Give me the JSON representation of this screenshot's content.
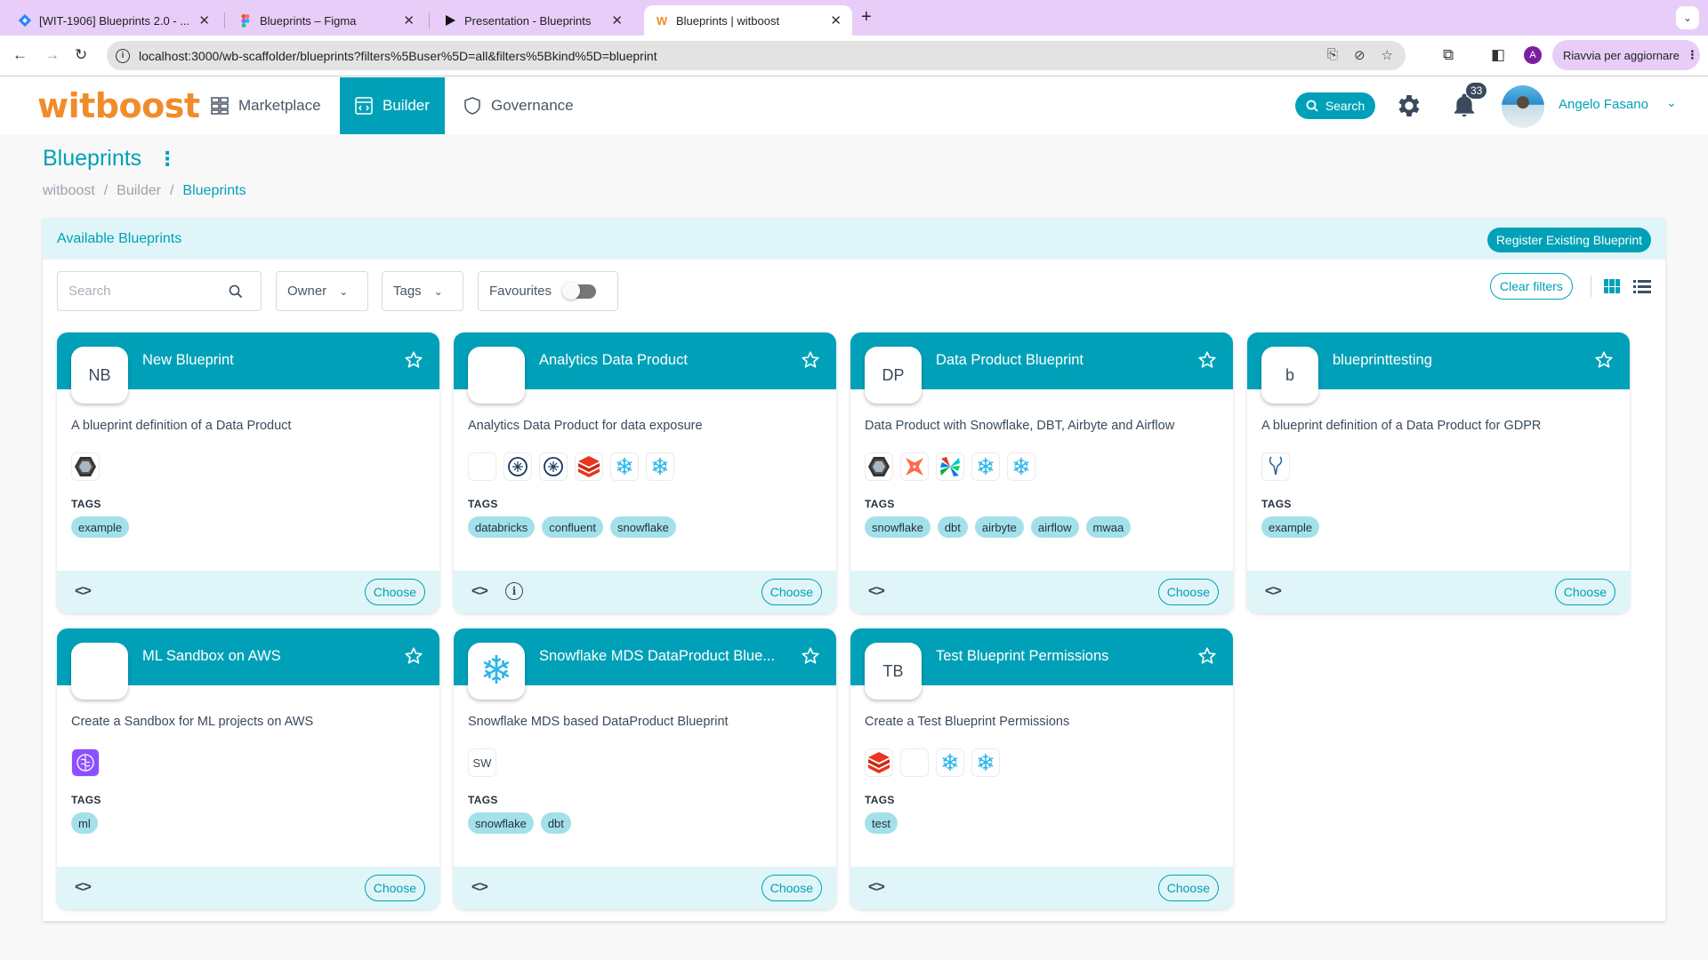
{
  "browser": {
    "tabs": [
      {
        "title": "[WIT-1906] Blueprints 2.0 - ...",
        "icon": "jira-icon",
        "active": false
      },
      {
        "title": "Blueprints – Figma",
        "icon": "figma-icon",
        "active": false
      },
      {
        "title": "Presentation - Blueprints",
        "icon": "play-icon",
        "active": false
      },
      {
        "title": "Blueprints | witboost",
        "icon": "witboost-w-icon",
        "active": true
      }
    ],
    "url": "localhost:3000/wb-scaffolder/blueprints?filters%5Buser%5D=all&filters%5Bkind%5D=blueprint",
    "profile_initial": "A",
    "update_button": "Riavvia per aggiornare"
  },
  "appbar": {
    "logo": "witboost",
    "nav": [
      {
        "label": "Marketplace",
        "icon": "grid-icon",
        "active": false
      },
      {
        "label": "Builder",
        "icon": "code-window-icon",
        "active": true
      },
      {
        "label": "Governance",
        "icon": "shield-icon",
        "active": false
      }
    ],
    "search_label": "Search",
    "notifications_count": "33",
    "user_name": "Angelo Fasano"
  },
  "page": {
    "title": "Blueprints",
    "breadcrumb": [
      "witboost",
      "Builder",
      "Blueprints"
    ]
  },
  "panel": {
    "title": "Available Blueprints",
    "register_button": "Register Existing Blueprint",
    "filters": {
      "search_placeholder": "Search",
      "owner": "Owner",
      "tags": "Tags",
      "favourites": "Favourites",
      "favourites_on": false
    },
    "clear_filters": "Clear filters",
    "view_mode": "grid"
  },
  "labels": {
    "tags_heading": "TAGS",
    "choose": "Choose"
  },
  "blueprints": [
    {
      "title": "New Blueprint",
      "avatar": "NB",
      "description": "A blueprint definition of a Data Product",
      "tech": [
        "hexagon"
      ],
      "tags": [
        "example"
      ],
      "info": false
    },
    {
      "title": "Analytics Data Product",
      "avatar": "",
      "description": "Analytics Data Product for data exposure",
      "tech": [
        "blank",
        "confluent",
        "confluent",
        "databricks",
        "snowflake",
        "snowflake"
      ],
      "tags": [
        "databricks",
        "confluent",
        "snowflake"
      ],
      "info": true
    },
    {
      "title": "Data Product Blueprint",
      "avatar": "DP",
      "description": "Data Product with Snowflake, DBT, Airbyte and Airflow",
      "tech": [
        "hexagon",
        "dbt",
        "airflow",
        "snowflake",
        "snowflake"
      ],
      "tags": [
        "snowflake",
        "dbt",
        "airbyte",
        "airflow",
        "mwaa"
      ],
      "info": false
    },
    {
      "title": "blueprinttesting",
      "avatar": "b",
      "description": "A blueprint definition of a Data Product for GDPR",
      "tech": [
        "antelope"
      ],
      "tags": [
        "example"
      ],
      "info": false
    },
    {
      "title": "ML Sandbox on AWS",
      "avatar": "",
      "description": "Create a Sandbox for ML projects on AWS",
      "tech": [
        "brain"
      ],
      "tags": [
        "ml"
      ],
      "info": false
    },
    {
      "title": "Snowflake MDS DataProduct Blue...",
      "avatar": "snowflake-logo",
      "description": "Snowflake MDS based DataProduct Blueprint",
      "tech": [
        "SW"
      ],
      "tags": [
        "snowflake",
        "dbt"
      ],
      "info": false
    },
    {
      "title": "Test Blueprint Permissions",
      "avatar": "TB",
      "description": "Create a Test Blueprint Permissions",
      "tech": [
        "databricks",
        "blank",
        "snowflake",
        "snowflake"
      ],
      "tags": [
        "test"
      ],
      "info": false
    }
  ],
  "colors": {
    "primary": "#00a1b8",
    "panel_header_bg": "#e0f5f8",
    "tag_bg": "#a3e1ea",
    "logo_orange": "#f18b2b",
    "chrome_purple": "#e8cdf9"
  }
}
